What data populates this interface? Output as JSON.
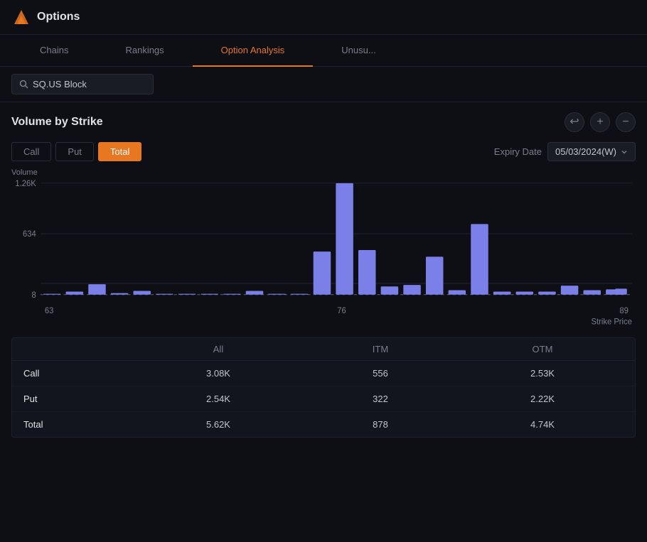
{
  "app": {
    "title": "Options",
    "logo_color": "#e87722"
  },
  "nav": {
    "tabs": [
      {
        "id": "chains",
        "label": "Chains",
        "active": false
      },
      {
        "id": "rankings",
        "label": "Rankings",
        "active": false
      },
      {
        "id": "option-analysis",
        "label": "Option Analysis",
        "active": true
      },
      {
        "id": "unusual",
        "label": "Unusu...",
        "active": false
      }
    ]
  },
  "search": {
    "value": "SQ.US Block",
    "placeholder": "Search..."
  },
  "chart": {
    "title": "Volume by Strike",
    "y_axis_title": "Volume",
    "x_axis_title": "Strike Price",
    "y_labels": [
      "1.26K",
      "634",
      "8"
    ],
    "x_labels": [
      "63",
      "76",
      "89"
    ],
    "filter_buttons": [
      {
        "id": "call",
        "label": "Call",
        "active": false
      },
      {
        "id": "put",
        "label": "Put",
        "active": false
      },
      {
        "id": "total",
        "label": "Total",
        "active": true
      }
    ],
    "expiry_label": "Expiry Date",
    "expiry_value": "05/03/2024(W)",
    "controls": {
      "undo": "↩",
      "zoom_in": "+",
      "zoom_out": "−"
    },
    "bars": [
      {
        "strike": 63,
        "value": 8,
        "rel": 0.006
      },
      {
        "strike": 64,
        "value": 30,
        "rel": 0.024
      },
      {
        "strike": 65,
        "value": 120,
        "rel": 0.095
      },
      {
        "strike": 66,
        "value": 15,
        "rel": 0.012
      },
      {
        "strike": 67,
        "value": 40,
        "rel": 0.032
      },
      {
        "strike": 68,
        "value": 10,
        "rel": 0.008
      },
      {
        "strike": 69,
        "value": 10,
        "rel": 0.008
      },
      {
        "strike": 70,
        "value": 8,
        "rel": 0.006
      },
      {
        "strike": 71,
        "value": 8,
        "rel": 0.006
      },
      {
        "strike": 72,
        "value": 40,
        "rel": 0.032
      },
      {
        "strike": 73,
        "value": 8,
        "rel": 0.006
      },
      {
        "strike": 74,
        "value": 8,
        "rel": 0.006
      },
      {
        "strike": 75,
        "value": 490,
        "rel": 0.389
      },
      {
        "strike": 76,
        "value": 1260,
        "rel": 1.0
      },
      {
        "strike": 77,
        "value": 500,
        "rel": 0.397
      },
      {
        "strike": 78,
        "value": 90,
        "rel": 0.071
      },
      {
        "strike": 79,
        "value": 110,
        "rel": 0.087
      },
      {
        "strike": 80,
        "value": 430,
        "rel": 0.341
      },
      {
        "strike": 81,
        "value": 50,
        "rel": 0.04
      },
      {
        "strike": 82,
        "value": 800,
        "rel": 0.635
      },
      {
        "strike": 83,
        "value": 35,
        "rel": 0.028
      },
      {
        "strike": 84,
        "value": 35,
        "rel": 0.028
      },
      {
        "strike": 85,
        "value": 35,
        "rel": 0.028
      },
      {
        "strike": 86,
        "value": 100,
        "rel": 0.079
      },
      {
        "strike": 87,
        "value": 50,
        "rel": 0.04
      },
      {
        "strike": 88,
        "value": 60,
        "rel": 0.048
      },
      {
        "strike": 89,
        "value": 70,
        "rel": 0.056
      }
    ]
  },
  "table": {
    "headers": [
      "",
      "All",
      "ITM",
      "OTM"
    ],
    "rows": [
      {
        "label": "Call",
        "all": "3.08K",
        "itm": "556",
        "otm": "2.53K"
      },
      {
        "label": "Put",
        "all": "2.54K",
        "itm": "322",
        "otm": "2.22K"
      },
      {
        "label": "Total",
        "all": "5.62K",
        "itm": "878",
        "otm": "4.74K"
      }
    ]
  }
}
